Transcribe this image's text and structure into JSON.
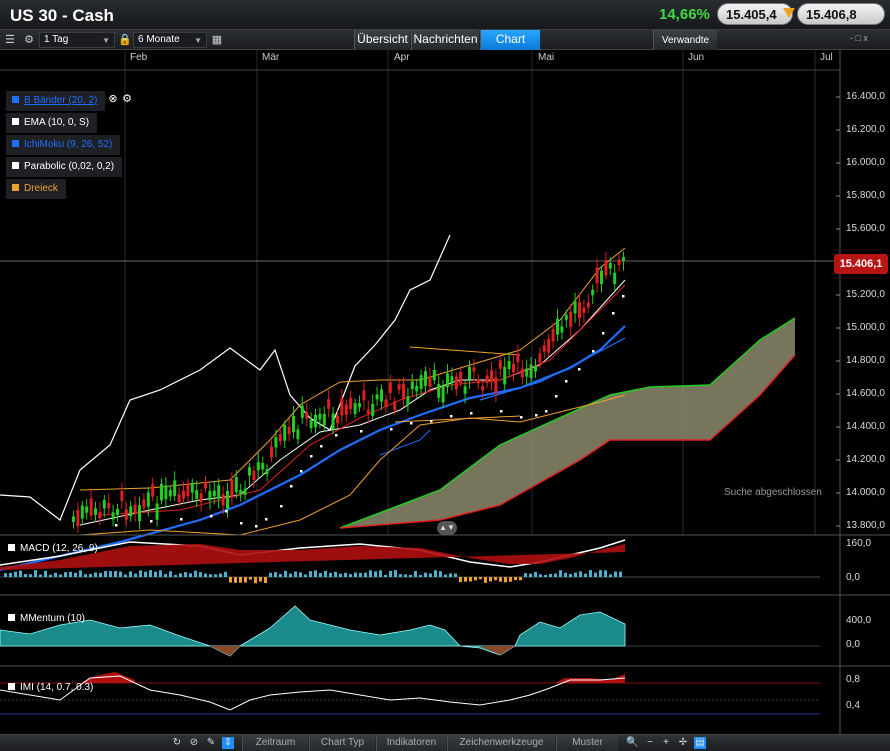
{
  "window": {
    "title": "US 30 - Cash",
    "change_pct": "14,66%",
    "bid": "15.405,4",
    "ask": "15.406,8"
  },
  "toolbar": {
    "interval": "1 Tag",
    "range": "6 Monate",
    "tabs": [
      {
        "label": "Übersicht"
      },
      {
        "label": "Nachrichten"
      },
      {
        "label": "Chart"
      }
    ],
    "verwandte": "Verwandte",
    "window_controls": "- □ x"
  },
  "chart": {
    "months": [
      "Feb",
      "Mär",
      "Apr",
      "Mai",
      "Jun",
      "Jul"
    ],
    "y_ticks": [
      "16.400,0",
      "16.200,0",
      "16.000,0",
      "15.800,0",
      "15.600,0",
      "15.400,0",
      "15.200,0",
      "15.000,0",
      "14.800,0",
      "14.600,0",
      "14.400,0",
      "14.200,0",
      "14.000,0",
      "13.800,0"
    ],
    "last_price": "15.406,1",
    "search_status": "Suche abgeschlossen",
    "colors": {
      "up": "#22cc22",
      "down": "#e02020",
      "bollinger": "#f0a030",
      "ema": "#ffffff",
      "ichimoku_a": "#22cc22",
      "ichimoku_b": "#e02020",
      "cloud": "#8c8a6c",
      "blue": "#1e6fff"
    },
    "indicators": [
      {
        "label": "B Bänder (20, 2)",
        "color": "#1e6fff"
      },
      {
        "label": "EMA (10, 0, S)",
        "color": "#ffffff"
      },
      {
        "label": "IchiMoku (9, 26, 52)",
        "color": "#1e6fff"
      },
      {
        "label": "Parabolic (0,02, 0,2)",
        "color": "#ffffff"
      },
      {
        "label": "Dreieck",
        "color": "#f0a030"
      }
    ]
  },
  "panels": {
    "macd": {
      "label": "MACD (12, 26, 9)",
      "ticks": [
        "160,0",
        "0,0"
      ]
    },
    "momentum": {
      "label": "MMentum (10)",
      "ticks": [
        "400,0",
        "0,0"
      ]
    },
    "imi": {
      "label": "IMI (14, 0.7, 0.3)",
      "ticks": [
        "0,8",
        "0,4"
      ]
    }
  },
  "bottom": {
    "buttons": [
      "Zeitraum",
      "Chart Typ",
      "Indikatoren",
      "Zeichenwerkzeuge",
      "Muster"
    ]
  }
}
